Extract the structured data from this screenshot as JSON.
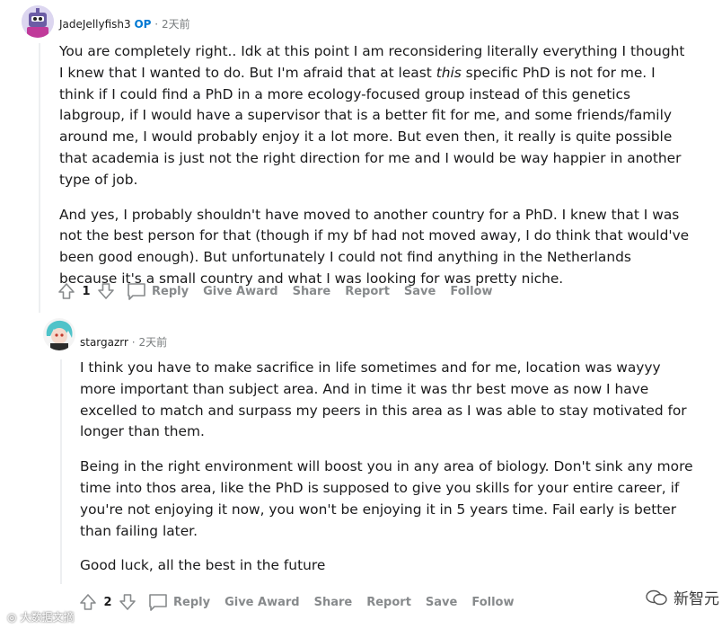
{
  "comment1": {
    "username": "JadeJellyfish3",
    "op_badge": "OP",
    "separator": "·",
    "time": "2天前",
    "paragraphs": [
      "You are completely right.. Idk at this point I am reconsidering literally everything I thought I knew that I wanted to do. But I'm afraid that at least ",
      "And yes, I probably shouldn't have moved to another country for a PhD. I knew that I was not the best person for that (though if my bf had not moved away, I do think that would've been good enough). But unfortunately I could not find anything in the Netherlands because it's a small country and what I was looking for was pretty niche."
    ],
    "p1_italic": "this",
    "p1_rest": " specific PhD is not for me. I think if I could find a PhD in a more ecology-focused group instead of this genetics labgroup, if I would have a supervisor that is a better fit for me, and some friends/family around me, I would probably enjoy it a lot more. But even then, it really is quite possible that academia is just not the right direction for me and I would be way happier in another type of job.",
    "votes": "1",
    "actions": [
      "Reply",
      "Give Award",
      "Share",
      "Report",
      "Save",
      "Follow"
    ]
  },
  "comment2": {
    "username": "stargazrr",
    "separator": "·",
    "time": "2天前",
    "paragraphs": [
      "I think you have to make sacrifice in life sometimes and for me, location was wayyy more important than subject area. And in time it was thr best move as now I have excelled to match and surpass my peers in this area as I was able to stay motivated for longer than them.",
      "Being in the right environment will boost you in any area of biology. Don't sink any more time into thos area, like the PhD is supposed to give you skills for your entire career, if you're not enjoying it now, you won't be enjoying it in 5 years time. Fail early is better than failing later.",
      "Good luck, all the best in the future"
    ],
    "votes": "2",
    "actions": [
      "Reply",
      "Give Award",
      "Share",
      "Report",
      "Save",
      "Follow"
    ]
  },
  "watermarks": {
    "left": "大数据文摘",
    "right": "新智元"
  },
  "icons": {
    "upvote": "upvote-icon",
    "downvote": "downvote-icon",
    "reply": "comment-bubble-icon"
  },
  "colors": {
    "op_blue": "#0079d3",
    "meta_gray": "#787c7e",
    "action_gray": "#878a8c",
    "thread_line": "#edeff1"
  }
}
